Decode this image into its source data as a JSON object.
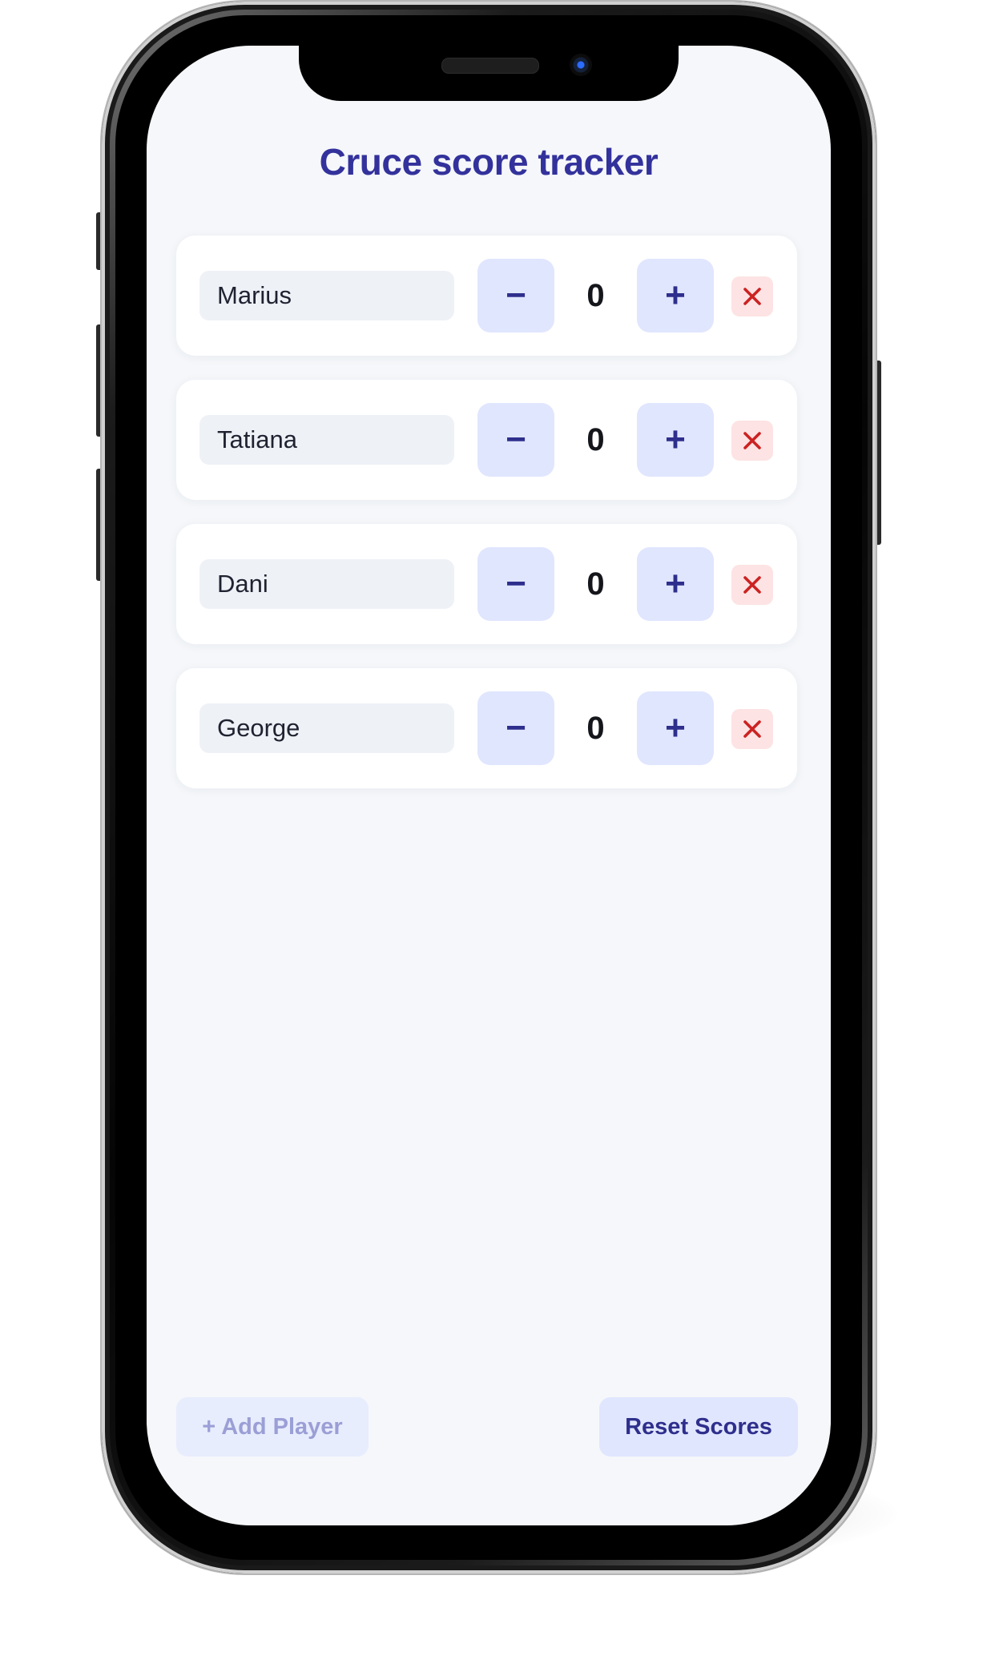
{
  "app": {
    "title": "Cruce score tracker"
  },
  "players": [
    {
      "name": "Marius",
      "score": "0"
    },
    {
      "name": "Tatiana",
      "score": "0"
    },
    {
      "name": "Dani",
      "score": "0"
    },
    {
      "name": "George",
      "score": "0"
    }
  ],
  "controls": {
    "decrement_label": "−",
    "increment_label": "+"
  },
  "footer": {
    "add_player_label": "+ Add Player",
    "reset_scores_label": "Reset Scores"
  },
  "icons": {
    "delete": "close-icon"
  },
  "colors": {
    "accent": "#33329c",
    "button_bg": "#e0e6fe",
    "delete_bg": "#fde3e3",
    "delete_fg": "#cc2222",
    "screen_bg": "#f5f7fa"
  }
}
